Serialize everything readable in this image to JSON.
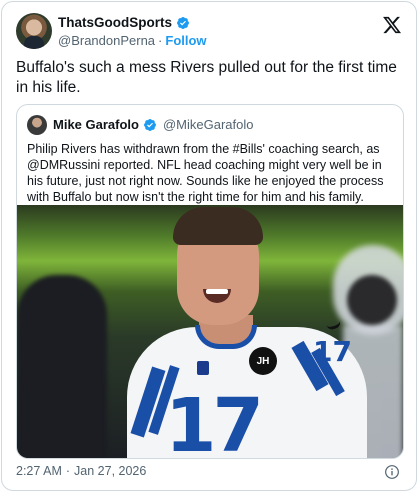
{
  "author": {
    "display_name": "ThatsGoodSports",
    "handle": "@BrandonPerna",
    "separator": "·",
    "follow_label": "Follow"
  },
  "tweet": {
    "text": "Buffalo's such a mess Rivers pulled out for the first time in his life."
  },
  "quote": {
    "display_name": "Mike Garafolo",
    "handle": "@MikeGarafolo",
    "text": "Philip Rivers has withdrawn from the #Bills' coaching search, as @DMRussini reported. NFL head coaching might very well be in his future, just not right now. Sounds like he enjoyed the process with Buffalo but now isn't the right time for him and his family.",
    "image": {
      "jersey_number": "17",
      "patch_text": "JH"
    }
  },
  "footer": {
    "time": "2:27 AM",
    "separator": "·",
    "date": "Jan 27, 2026"
  },
  "icons": {
    "verified": "verified-badge-icon",
    "platform": "x-logo-icon",
    "info": "info-icon"
  },
  "colors": {
    "accent": "#1d9bf0",
    "text": "#0f1419",
    "secondary": "#536471",
    "border": "#cfd9de",
    "jersey_blue": "#1a4fa8"
  }
}
